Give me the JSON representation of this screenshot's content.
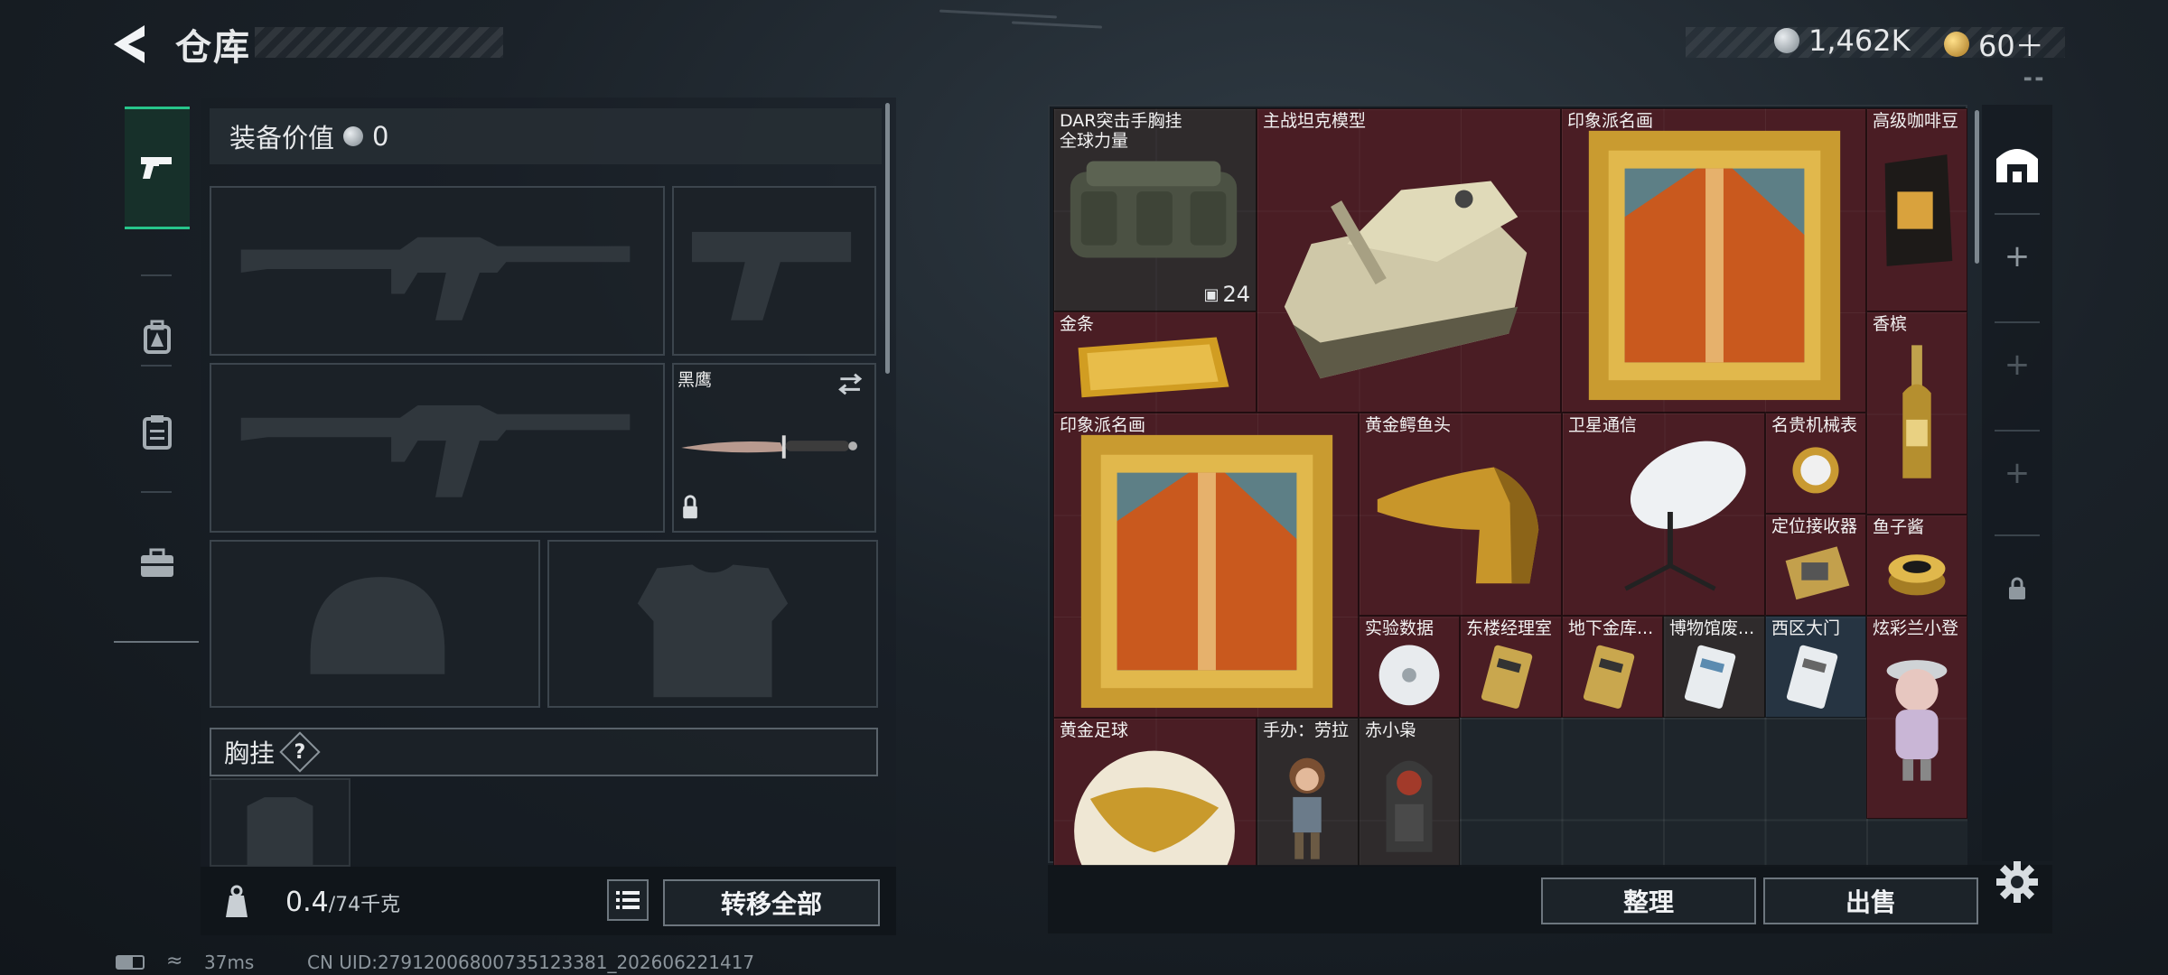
{
  "header": {
    "title": "仓库",
    "currencies": [
      {
        "icon": "silver-coin-icon",
        "value": "1,462K"
      },
      {
        "icon": "gold-coin-icon",
        "value": "60＋"
      }
    ]
  },
  "side_tabs": [
    {
      "name": "weapons",
      "icon": "pistol-icon",
      "active": true
    },
    {
      "name": "gear",
      "icon": "backpack-icon",
      "active": false
    },
    {
      "name": "cases",
      "icon": "clipboard-icon",
      "active": false
    },
    {
      "name": "supplies",
      "icon": "toolbox-icon",
      "active": false
    }
  ],
  "equipment": {
    "value_label": "装备价值",
    "value": "0",
    "melee_label": "黑鹰",
    "chest_section_label": "胸挂",
    "help_symbol": "?",
    "weight_value": "0.4",
    "weight_max": "/74千克",
    "transfer_all": "转移全部"
  },
  "storage": {
    "items": [
      {
        "label": "DAR突击手胸挂\n全球力量",
        "color": "#4a3c34",
        "count": "24"
      },
      {
        "label": "主战坦克模型"
      },
      {
        "label": "印象派名画"
      },
      {
        "label": "高级咖啡豆"
      },
      {
        "label": "金条"
      },
      {
        "label": "香槟"
      },
      {
        "label": "印象派名画"
      },
      {
        "label": "黄金鳄鱼头"
      },
      {
        "label": "卫星通信"
      },
      {
        "label": "名贵机械表"
      },
      {
        "label": "定位接收器"
      },
      {
        "label": "鱼子酱"
      },
      {
        "label": "实验数据"
      },
      {
        "label": "东楼经理室"
      },
      {
        "label": "地下金库..."
      },
      {
        "label": "博物馆废..."
      },
      {
        "label": "西区大门"
      },
      {
        "label": "炫彩兰小登"
      },
      {
        "label": "黄金足球"
      },
      {
        "label": "手办：劳拉"
      },
      {
        "label": "赤小枭"
      }
    ],
    "sort_button": "整理",
    "sell_button": "出售"
  },
  "right_column": {
    "plus_symbol": "+"
  },
  "status_bar": {
    "ping": "37ms",
    "uid": "CN UID:27912006800735123381_202606221417"
  },
  "colors": {
    "accent_green": "#27c58b",
    "item_red": "#4a1d24"
  }
}
